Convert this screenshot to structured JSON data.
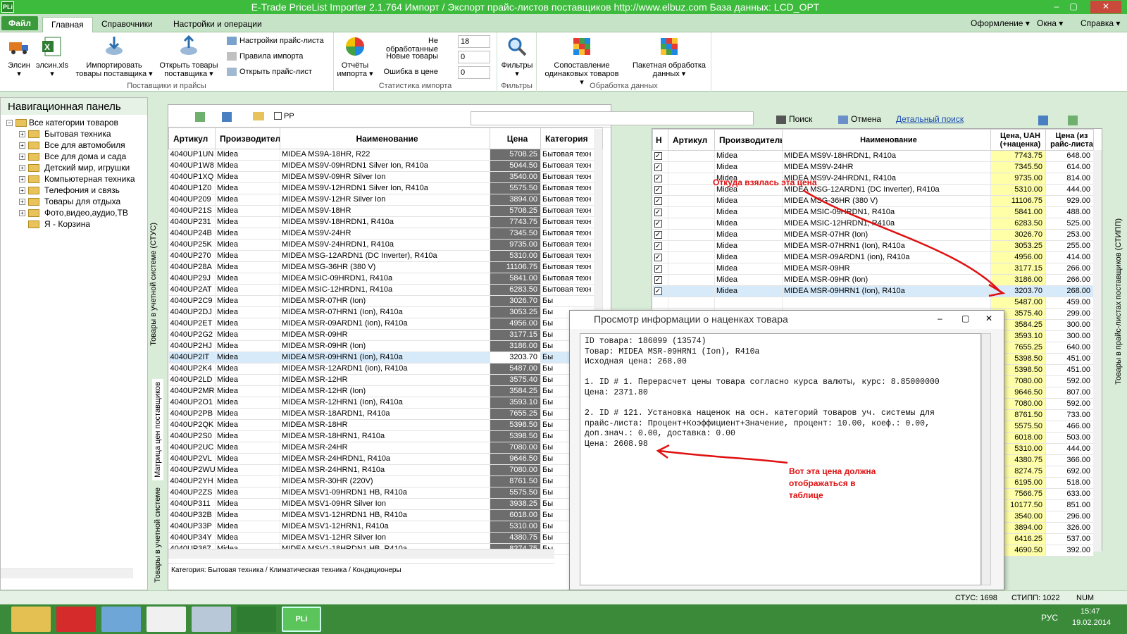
{
  "app": {
    "title": "E-Trade PriceList Importer 2.1.764      Импорт / Экспорт прайс-листов поставщиков      http://www.elbuz.com      База данных: LCD_OPT",
    "logo": "PLi",
    "min": "‒",
    "max": "▢",
    "close": "✕"
  },
  "menu": {
    "file": "Файл",
    "tabs": [
      "Главная",
      "Справочники",
      "Настройки и операции"
    ],
    "right": [
      "Оформление ▾",
      "Окна ▾",
      "Справка ▾"
    ]
  },
  "ribbon": {
    "btn_elsin": "Элсин",
    "btn_elsinxls": "элсин.xls",
    "btn_import": "Импортировать товары поставщика ▾",
    "btn_open": "Открыть товары поставщика ▾",
    "small": [
      "Настройки прайс-листа",
      "Правила импорта",
      "Открыть прайс-лист"
    ],
    "group1": "Поставщики и прайсы",
    "reports": "Отчёты импорта ▾",
    "stats": [
      {
        "label": "Не обработанные",
        "value": "18"
      },
      {
        "label": "Новые товары",
        "value": "0"
      },
      {
        "label": "Ошибка в цене",
        "value": "0"
      }
    ],
    "group2": "Статистика импорта",
    "filters": "Фильтры ▾",
    "group3": "Фильтры",
    "match": "Сопоставление одинаковых товаров ▾",
    "batch": "Пакетная обработка данных ▾",
    "group4": "Обработка данных"
  },
  "nav": {
    "title": "Навигационная панель",
    "items": [
      {
        "label": "Все категории товаров",
        "root": true
      },
      {
        "label": "Бытовая техника"
      },
      {
        "label": "Все для автомобиля"
      },
      {
        "label": "Все для дома и сада"
      },
      {
        "label": "Детский мир, игрушки"
      },
      {
        "label": "Компьютерная техника"
      },
      {
        "label": "Телефония и связь"
      },
      {
        "label": "Товары для отдыха"
      },
      {
        "label": "Фото,видео,аудио,ТВ"
      },
      {
        "label": "Я - Корзина",
        "nopm": true
      }
    ]
  },
  "vtabs": [
    "Товары в учетной системе (СТУС)",
    "Матрица цен поставщиков",
    "Товары в учетной системе"
  ],
  "leftgrid": {
    "rp_label": "РР",
    "search": "Поиск",
    "cancel": "Отмена",
    "detailed": "Детальный поиск",
    "columns": [
      "Артикул",
      "Производитель",
      "Наименование",
      "Цена",
      "Категория"
    ],
    "rows": [
      [
        "4040UP1UN",
        "Midea",
        "MIDEA MS9A-18HR, R22",
        "5708.25",
        "Бытовая техн"
      ],
      [
        "4040UP1W8",
        "Midea",
        "MIDEA MS9V-09HRDN1 Silver Ion, R410a",
        "5044.50",
        "Бытовая техн"
      ],
      [
        "4040UP1XQ",
        "Midea",
        "MIDEA MS9V-09HR Silver Ion",
        "3540.00",
        "Бытовая техн"
      ],
      [
        "4040UP1Z0",
        "Midea",
        "MIDEA MS9V-12HRDN1 Silver Ion, R410a",
        "5575.50",
        "Бытовая техн"
      ],
      [
        "4040UP209",
        "Midea",
        "MIDEA MS9V-12HR Silver Ion",
        "3894.00",
        "Бытовая техн"
      ],
      [
        "4040UP21S",
        "Midea",
        "MIDEA MS9V-18HR",
        "5708.25",
        "Бытовая техн"
      ],
      [
        "4040UP231",
        "Midea",
        "MIDEA MS9V-18HRDN1, R410a",
        "7743.75",
        "Бытовая техн"
      ],
      [
        "4040UP24B",
        "Midea",
        "MIDEA MS9V-24HR",
        "7345.50",
        "Бытовая техн"
      ],
      [
        "4040UP25K",
        "Midea",
        "MIDEA MS9V-24HRDN1, R410a",
        "9735.00",
        "Бытовая техн"
      ],
      [
        "4040UP270",
        "Midea",
        "MIDEA MSG-12ARDN1 (DC Inverter), R410a",
        "5310.00",
        "Бытовая техн"
      ],
      [
        "4040UP28A",
        "Midea",
        "MIDEA MSG-36HR (380 V)",
        "11106.75",
        "Бытовая техн"
      ],
      [
        "4040UP29J",
        "Midea",
        "MIDEA MSIC-09HRDN1, R410a",
        "5841.00",
        "Бытовая техн"
      ],
      [
        "4040UP2AT",
        "Midea",
        "MIDEA MSIC-12HRDN1, R410a",
        "6283.50",
        "Бытовая техн"
      ],
      [
        "4040UP2C9",
        "Midea",
        "MIDEA MSR-07HR (Ion)",
        "3026.70",
        "Бы"
      ],
      [
        "4040UP2DJ",
        "Midea",
        "MIDEA MSR-07HRN1 (Ion), R410a",
        "3053.25",
        "Бы"
      ],
      [
        "4040UP2ET",
        "Midea",
        "MIDEA MSR-09ARDN1 (ion), R410a",
        "4956.00",
        "Бы"
      ],
      [
        "4040UP2G2",
        "Midea",
        "MIDEA MSR-09HR",
        "3177.15",
        "Бы"
      ],
      [
        "4040UP2HJ",
        "Midea",
        "MIDEA MSR-09HR (Ion)",
        "3186.00",
        "Бы"
      ],
      [
        "4040UP2IT",
        "Midea",
        "MIDEA MSR-09HRN1 (Ion), R410a",
        "3203.70",
        "Бы"
      ],
      [
        "4040UP2K4",
        "Midea",
        "MIDEA MSR-12ARDN1 (ion), R410a",
        "5487.00",
        "Бы"
      ],
      [
        "4040UP2LD",
        "Midea",
        "MIDEA MSR-12HR",
        "3575.40",
        "Бы"
      ],
      [
        "4040UP2MR",
        "Midea",
        "MIDEA MSR-12HR (Ion)",
        "3584.25",
        "Бы"
      ],
      [
        "4040UP2O1",
        "Midea",
        "MIDEA MSR-12HRN1 (Ion), R410a",
        "3593.10",
        "Бы"
      ],
      [
        "4040UP2PB",
        "Midea",
        "MIDEA MSR-18ARDN1, R410a",
        "7655.25",
        "Бы"
      ],
      [
        "4040UP2QK",
        "Midea",
        "MIDEA MSR-18HR",
        "5398.50",
        "Бы"
      ],
      [
        "4040UP2S0",
        "Midea",
        "MIDEA MSR-18HRN1, R410a",
        "5398.50",
        "Бы"
      ],
      [
        "4040UP2UC",
        "Midea",
        "MIDEA MSR-24HR",
        "7080.00",
        "Бы"
      ],
      [
        "4040UP2VL",
        "Midea",
        "MIDEA MSR-24HRDN1, R410a",
        "9646.50",
        "Бы"
      ],
      [
        "4040UP2WU",
        "Midea",
        "MIDEA MSR-24HRN1, R410a",
        "7080.00",
        "Бы"
      ],
      [
        "4040UP2YH",
        "Midea",
        "MIDEA MSR-30HR (220V)",
        "8761.50",
        "Бы"
      ],
      [
        "4040UP2ZS",
        "Midea",
        "MIDEA MSV1-09HRDN1 HB, R410a",
        "5575.50",
        "Бы"
      ],
      [
        "4040UP311",
        "Midea",
        "MIDEA MSV1-09HR Silver Ion",
        "3938.25",
        "Бы"
      ],
      [
        "4040UP32B",
        "Midea",
        "MIDEA MSV1-12HRDN1 HB, R410a",
        "6018.00",
        "Бы"
      ],
      [
        "4040UP33P",
        "Midea",
        "MIDEA MSV1-12HRN1, R410a",
        "5310.00",
        "Бы"
      ],
      [
        "4040UP34Y",
        "Midea",
        "MIDEA MSV1-12HR Silver Ion",
        "4380.75",
        "Бы"
      ],
      [
        "4040UP367",
        "Midea",
        "MIDEA MSV1-18HRDN1 HB, R410a",
        "8274.75",
        "Бы"
      ]
    ],
    "footer": "Категория: Бытовая техника / Климатическая техника / Кондиционеры"
  },
  "rightgrid": {
    "columns": [
      "Н",
      "Артикул",
      "Производитель",
      "Наименование",
      "Цена, UAH (+наценка)",
      "Цена (из райс-листа"
    ],
    "rows": [
      [
        "Midea",
        "MIDEA MS9V-18HRDN1, R410a",
        "7743.75",
        "648.00"
      ],
      [
        "Midea",
        "MIDEA MS9V-24HR",
        "7345.50",
        "614.00"
      ],
      [
        "Midea",
        "MIDEA MS9V-24HRDN1, R410a",
        "9735.00",
        "814.00"
      ],
      [
        "Midea",
        "MIDEA MSG-12ARDN1 (DC Inverter), R410a",
        "5310.00",
        "444.00"
      ],
      [
        "Midea",
        "MIDEA MSG-36HR (380 V)",
        "11106.75",
        "929.00"
      ],
      [
        "Midea",
        "MIDEA MSIC-09HRDN1, R410a",
        "5841.00",
        "488.00"
      ],
      [
        "Midea",
        "MIDEA MSIC-12HRDN1, R410a",
        "6283.50",
        "525.00"
      ],
      [
        "Midea",
        "MIDEA MSR-07HR (Ion)",
        "3026.70",
        "253.00"
      ],
      [
        "Midea",
        "MIDEA MSR-07HRN1 (Ion), R410a",
        "3053.25",
        "255.00"
      ],
      [
        "Midea",
        "MIDEA MSR-09ARDN1 (ion), R410a",
        "4956.00",
        "414.00"
      ],
      [
        "Midea",
        "MIDEA MSR-09HR",
        "3177.15",
        "266.00"
      ],
      [
        "Midea",
        "MIDEA MSR-09HR (Ion)",
        "3186.00",
        "266.00"
      ],
      [
        "Midea",
        "MIDEA MSR-09HRN1 (Ion), R410a",
        "3203.70",
        "268.00"
      ],
      [
        "",
        "",
        "5487.00",
        "459.00"
      ],
      [
        "",
        "",
        "3575.40",
        "299.00"
      ],
      [
        "",
        "",
        "3584.25",
        "300.00"
      ],
      [
        "",
        "",
        "3593.10",
        "300.00"
      ],
      [
        "",
        "",
        "7655.25",
        "640.00"
      ],
      [
        "",
        "",
        "5398.50",
        "451.00"
      ],
      [
        "",
        "",
        "5398.50",
        "451.00"
      ],
      [
        "",
        "",
        "7080.00",
        "592.00"
      ],
      [
        "",
        "",
        "9646.50",
        "807.00"
      ],
      [
        "",
        "",
        "7080.00",
        "592.00"
      ],
      [
        "",
        "",
        "8761.50",
        "733.00"
      ],
      [
        "",
        "",
        "5575.50",
        "466.00"
      ],
      [
        "",
        "",
        "6018.00",
        "503.00"
      ],
      [
        "",
        "",
        "5310.00",
        "444.00"
      ],
      [
        "",
        "",
        "4380.75",
        "366.00"
      ],
      [
        "",
        "",
        "8274.75",
        "692.00"
      ],
      [
        "",
        "",
        "6195.00",
        "518.00"
      ],
      [
        "",
        "",
        "7566.75",
        "633.00"
      ],
      [
        "",
        "",
        "10177.50",
        "851.00"
      ],
      [
        "",
        "",
        "3540.00",
        "296.00"
      ],
      [
        "",
        "",
        "3894.00",
        "326.00"
      ],
      [
        "",
        "",
        "6416.25",
        "537.00"
      ],
      [
        "",
        "",
        "4690.50",
        "392.00"
      ]
    ]
  },
  "right_vtab": "Товары в прайс-листах поставщиков (СТИПП)",
  "dialog": {
    "title": "Просмотр информации о наценках товара",
    "text": "ID товара: 186099 (13574)\nТовар: MIDEA MSR-09HRN1 (Ion), R410a\nИсходная цена: 268.00\n\n1. ID # 1. Перерасчет цены товара согласно курса валюты, курс: 8.85000000\nЦена: 2371.80\n\n2. ID # 121. Установка наценок на осн. категорий товаров уч. системы для\nпрайс-листа: Процент+Коэффициент+Значение, процент: 10.00, коеф.: 0.00,\nдоп.знач.: 0.00, доставка: 0.00\nЦена: 2608.98"
  },
  "annotations": {
    "a1": "Откуда взялась эта цена",
    "a2": "Вот эта цена должна отображаться в таблице"
  },
  "statusbar": {
    "stus": "СТУС: 1698",
    "stipp": "СТИПП: 1022",
    "num": "NUM"
  },
  "taskbar": {
    "lang": "РУС",
    "time": "15:47",
    "date": "19.02.2014",
    "pli": "PLi"
  }
}
